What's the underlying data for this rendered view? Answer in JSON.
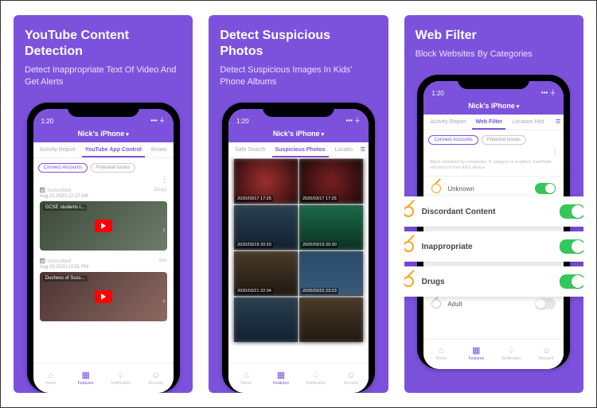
{
  "panels": [
    {
      "title": "YouTube Content Detection",
      "subtitle": "Detect Inappropriate Text Of Video And Get Alerts"
    },
    {
      "title": "Detect Suspicious Photos",
      "subtitle": "Detect Suspicious Images In Kids' Phone Albums"
    },
    {
      "title": "Web Filter",
      "subtitle": "Block Websites By Categories"
    }
  ],
  "status_time": "1:20",
  "device_name": "Nick's iPhone",
  "p1_tabs": {
    "a": "Activity Report",
    "b": "YouTube App Control",
    "c": "Brows"
  },
  "p1_chips": {
    "a": "Connect Accounts",
    "b": "Potential Issues"
  },
  "p1_rows": [
    {
      "label": "Subscribed",
      "tag": "Drugs",
      "ts": "Aug 21,2020,12:17 AM",
      "vtitle": "GCSE students t..."
    },
    {
      "label": "Subscribed",
      "tag": "Sex",
      "ts": "Aug 20,2020,10:51 PM",
      "vtitle": "Duchess of Suss..."
    }
  ],
  "p2_tabs": {
    "a": "Safe Search",
    "b": "Suspicious Photos",
    "c": "Locatio"
  },
  "p2_stamps": [
    "2020/03/17 17:25",
    "2020/03/17 17:25",
    "2020/03/19 20:20",
    "2020/03/19 20:30",
    "2020/03/21 22:34",
    "2020/03/22 23:23"
  ],
  "p3_tabs": {
    "a": "Activity Report",
    "b": "Web Filter",
    "c": "Location Hist"
  },
  "p3_chips": {
    "a": "Connect Accounts",
    "b": "Potential Issues"
  },
  "p3_note": "Block websites by categories. If category is enabled, FamiSafe will block it from kid's device.",
  "p3_items": {
    "unknown": "Unknown",
    "discordant": "Discordant Content",
    "inapp": "Inappropriate",
    "drugs": "Drugs",
    "adult": "Adult"
  },
  "nav": {
    "home": "Home",
    "features": "Features",
    "notif": "Notification",
    "account": "Account"
  }
}
